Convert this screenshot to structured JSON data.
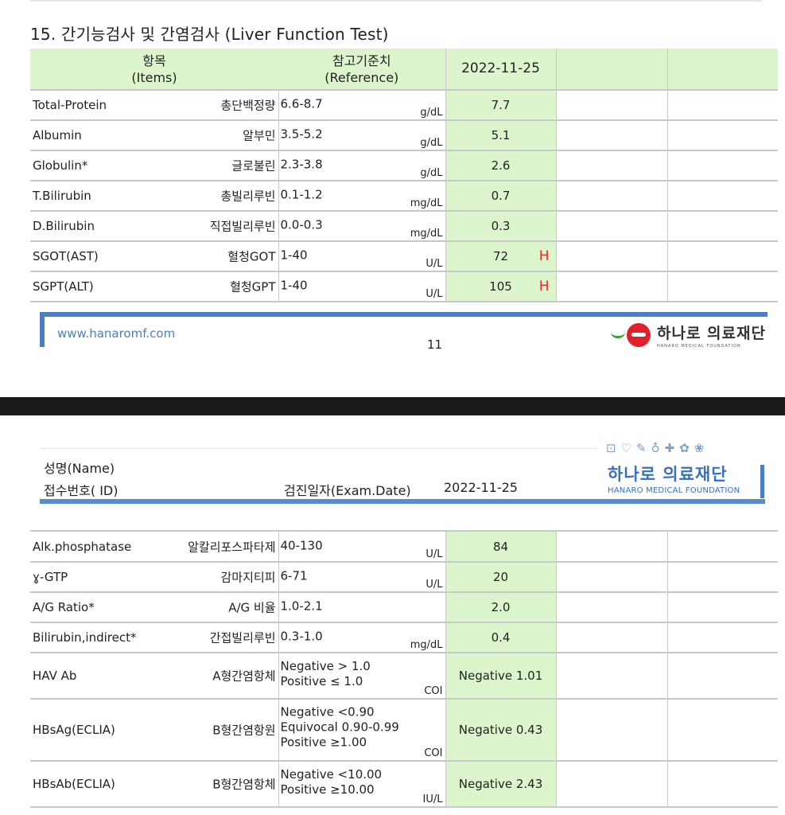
{
  "section_title": "15. 간기능검사 및 간염검사 (Liver Function Test)",
  "header": {
    "items_kr": "항목",
    "items_en": "(Items)",
    "ref_kr": "참고기준치",
    "ref_en": "(Reference)",
    "date": "2022-11-25"
  },
  "rows1": [
    {
      "name": "Total-Protein",
      "kor": "총단백정량",
      "ref": "6.6-8.7",
      "unit": "g/dL",
      "value": "7.7",
      "flag": ""
    },
    {
      "name": "Albumin",
      "kor": "알부민",
      "ref": "3.5-5.2",
      "unit": "g/dL",
      "value": "5.1",
      "flag": ""
    },
    {
      "name": "Globulin*",
      "kor": "글로불린",
      "ref": "2.3-3.8",
      "unit": "g/dL",
      "value": "2.6",
      "flag": ""
    },
    {
      "name": "T.Bilirubin",
      "kor": "총빌리루빈",
      "ref": "0.1-1.2",
      "unit": "mg/dL",
      "value": "0.7",
      "flag": ""
    },
    {
      "name": "D.Bilirubin",
      "kor": "직접빌리루빈",
      "ref": "0.0-0.3",
      "unit": "mg/dL",
      "value": "0.3",
      "flag": ""
    },
    {
      "name": "SGOT(AST)",
      "kor": "혈청GOT",
      "ref": "1-40",
      "unit": "U/L",
      "value": "72",
      "flag": "H"
    },
    {
      "name": "SGPT(ALT)",
      "kor": "혈청GPT",
      "ref": "1-40",
      "unit": "U/L",
      "value": "105",
      "flag": "H"
    }
  ],
  "footer": {
    "url": "www.hanaromf.com",
    "page": "11",
    "logo_kr": "하나로 의료재단",
    "logo_en": "HANARO MEDICAL FOUNDATION"
  },
  "page2": {
    "icons": "⊡♡✎♁✚✿❀",
    "name_label": "성명(Name)",
    "id_label": "접수번호( ID)",
    "exam_label": "검진일자(Exam.Date)",
    "exam_date": "2022-11-25",
    "logo_kr": "하나로 의료재단",
    "logo_en": "HANARO MEDICAL FOUNDATION"
  },
  "rows2": [
    {
      "name": "Alk.phosphatase",
      "kor": "알칼리포스파타제",
      "ref": "40-130",
      "unit": "U/L",
      "value": "84"
    },
    {
      "name": "ɣ-GTP",
      "kor": "감마지티피",
      "ref": "6-71",
      "unit": "U/L",
      "value": "20"
    },
    {
      "name": "A/G Ratio*",
      "kor": "A/G 비율",
      "ref": "1.0-2.1",
      "unit": "",
      "value": "2.0"
    },
    {
      "name": "Bilirubin,indirect*",
      "kor": "간접빌리루빈",
      "ref": "0.3-1.0",
      "unit": "mg/dL",
      "value": "0.4"
    },
    {
      "name": "HAV Ab",
      "kor": "A형간염항체",
      "ref_lines": [
        "Negative > 1.0",
        "Positive ≤ 1.0"
      ],
      "unit": "COI",
      "value": "Negative 1.01"
    },
    {
      "name": "HBsAg(ECLIA)",
      "kor": "B형간염항원",
      "ref_lines": [
        "Negative  <0.90",
        "Equivocal 0.90-0.99",
        "Positive  ≥1.00"
      ],
      "unit": "COI",
      "value": "Negative 0.43"
    },
    {
      "name": "HBsAb(ECLIA)",
      "kor": "B형간염항체",
      "ref_lines": [
        "Negative <10.00",
        "Positive ≥10.00"
      ],
      "unit": "IU/L",
      "value": "Negative 2.43"
    }
  ]
}
